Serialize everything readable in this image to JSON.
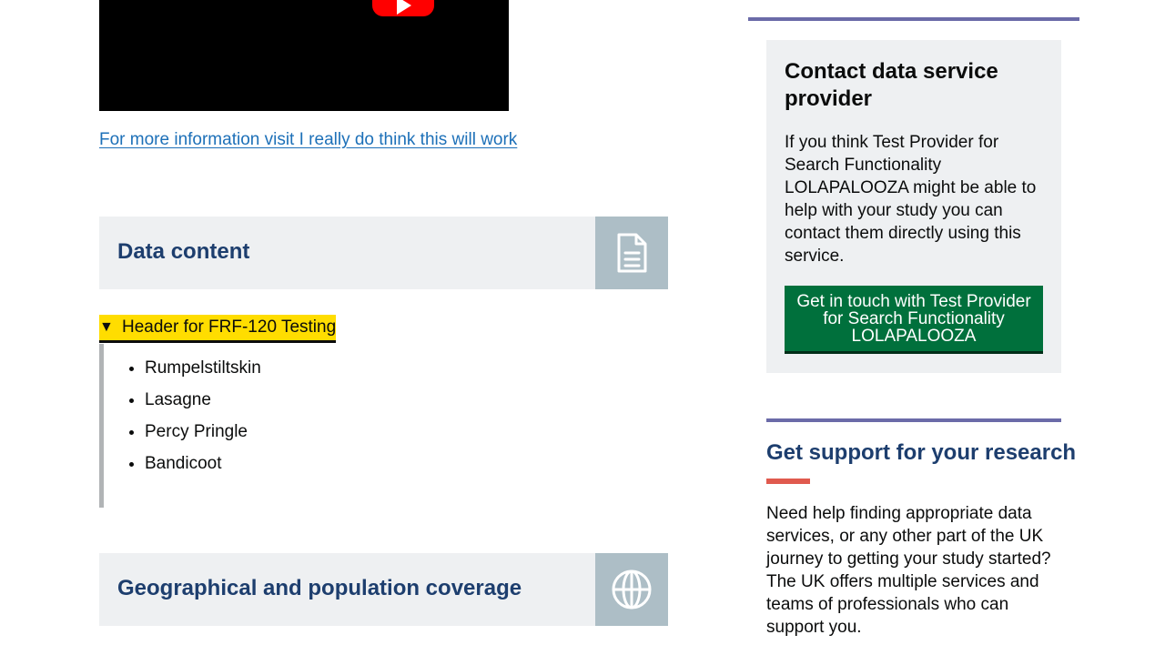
{
  "video": {
    "play_icon": "youtube-play-icon"
  },
  "more_info_link": "For more information visit I really do think this will work",
  "sections": {
    "data_content": {
      "title": "Data content",
      "icon": "document-icon"
    },
    "geo_coverage": {
      "title": "Geographical and population coverage",
      "icon": "globe-icon"
    }
  },
  "details": {
    "summary": "Header for FRF-120 Testing",
    "toggle_icon": "triangle-down-icon",
    "items": [
      "Rumpelstiltskin",
      "Lasagne",
      "Percy Pringle",
      "Bandicoot"
    ]
  },
  "contact": {
    "heading": "Contact data service provider",
    "text": "If you think Test Provider for Search Functionality LOLAPALOOZA might be able to help with your study you can contact them directly using this service.",
    "button_label": "Get in touch with Test Provider for Search Functionality LOLAPALOOZA"
  },
  "support": {
    "title": "Get support for your research",
    "text": "Need help finding appropriate data services, or any other part of the UK journey to getting your study started? The UK offers multiple services and teams of professionals who can support you."
  },
  "colors": {
    "link": "#1d70b8",
    "heading_blue": "#1d3e6e",
    "panel_bg": "#eef0f2",
    "icon_bg": "#adbec6",
    "button_green": "#00703c",
    "focus_yellow": "#ffdd00",
    "rule_purple": "#6b6ba8",
    "accent_red": "#e05a4e"
  }
}
